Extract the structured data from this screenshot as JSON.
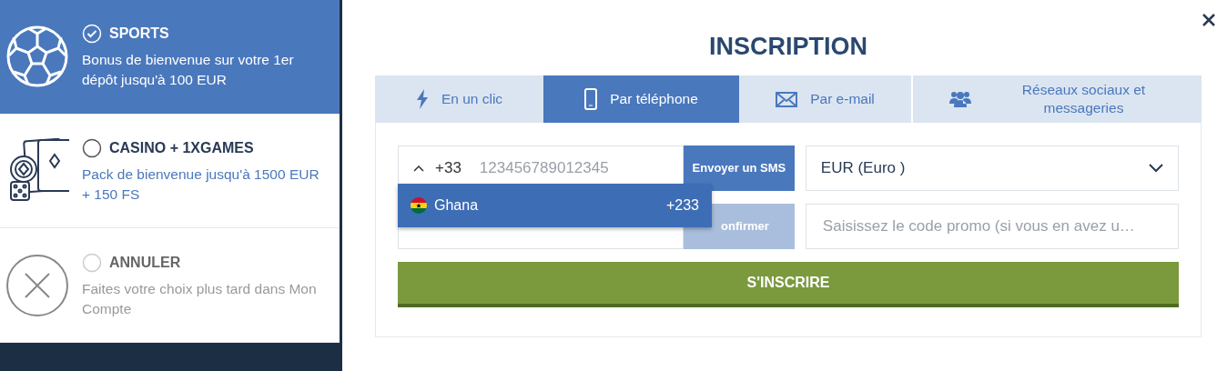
{
  "options": [
    {
      "kind": "sports",
      "title": "SPORTS",
      "description": "Bonus de bienvenue sur votre 1er dépôt jusqu'à 100 EUR",
      "selected": true
    },
    {
      "kind": "casino",
      "title": "CASINO + 1XGAMES",
      "description": "Pack de bienvenue jusqu'à 1500 EUR + 150 FS",
      "selected": false
    },
    {
      "kind": "cancel",
      "title": "ANNULER",
      "description": "Faites votre choix plus tard dans Mon Compte",
      "selected": false
    }
  ],
  "modal": {
    "title": "INSCRIPTION",
    "tabs": [
      {
        "kind": "bolt",
        "label": "En un clic",
        "selected": false
      },
      {
        "kind": "phone",
        "label": "Par téléphone",
        "selected": true
      },
      {
        "kind": "mail",
        "label": "Par e-mail",
        "selected": false
      },
      {
        "kind": "people",
        "label": "Réseaux sociaux et messageries",
        "selected": false
      }
    ],
    "phone": {
      "code": "+33",
      "placeholder": "123456789012345",
      "expanded": true
    },
    "sms_button": "Envoyer un SMS",
    "currency": "EUR (Euro )",
    "confirm_button": "onfirmer",
    "promo_placeholder": "Saisissez le code promo (si vous en avez u…",
    "submit": "S'INSCRIRE",
    "countries": [
      {
        "name": "Ghana",
        "code": "+233",
        "selected": true
      }
    ]
  }
}
